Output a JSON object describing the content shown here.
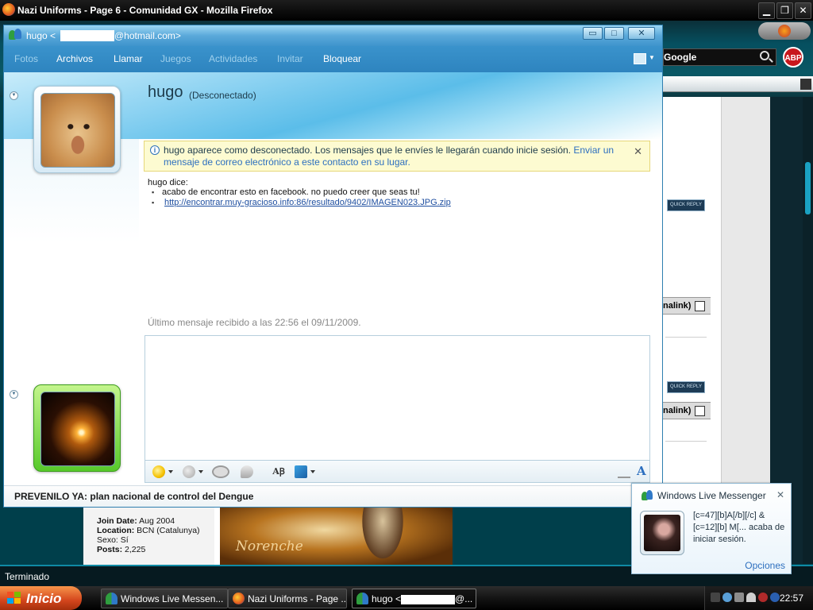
{
  "firefox": {
    "title": "Nazi Uniforms - Page 6 - Comunidad GX - Mozilla Firefox",
    "search_engine": "Google",
    "adblock_label": "ABP",
    "status": "Terminado",
    "win_buttons": [
      "▁",
      "❐",
      "✕"
    ]
  },
  "forum": {
    "quick_reply": "QUICK REPLY",
    "permalink": "nalink)",
    "join_date_label": "Join Date:",
    "join_date": "Aug 2004",
    "location_label": "Location:",
    "location": "BCN (Catalunya)",
    "sexo": "Sexo: Sí",
    "posts_label": "Posts:",
    "posts": "2,225",
    "banner_name": "Norenche"
  },
  "messenger": {
    "title_prefix": "hugo <",
    "title_suffix": "@hotmail.com>",
    "win_buttons": [
      "▭",
      "□",
      "✕"
    ],
    "menu": [
      {
        "label": "Fotos",
        "enabled": false
      },
      {
        "label": "Archivos",
        "enabled": true
      },
      {
        "label": "Llamar",
        "enabled": true
      },
      {
        "label": "Juegos",
        "enabled": false
      },
      {
        "label": "Actividades",
        "enabled": false
      },
      {
        "label": "Invitar",
        "enabled": false
      },
      {
        "label": "Bloquear",
        "enabled": true
      }
    ],
    "contact_name": "hugo",
    "contact_status": "(Desconectado)",
    "notice": {
      "text": "hugo aparece como desconectado. Los mensajes que le envíes le llegarán cuando inicie sesión. ",
      "link": "Enviar un mensaje de correo electrónico a este contacto en su lugar.",
      "close": "✕"
    },
    "conversation": {
      "sender_line": "hugo dice:",
      "message": "acabo de encontrar esto en facebook. no puedo creer que seas tu!",
      "url": "http://encontrar.muy-gracioso.info:86/resultado/9402/IMAGEN023.JPG.zip"
    },
    "last_message": "Último mensaje recibido a las 22:56 el 09/11/2009.",
    "footer": "PREVENILO YA: plan nacional de control del Dengue",
    "toolbar": {
      "font_label": "AꞴ",
      "big_a": "A"
    }
  },
  "toast": {
    "title": "Windows Live Messenger",
    "close": "✕",
    "message": "[c=47][b]A[/b][/c] &[c=12][b] M[... acaba de iniciar sesión.",
    "options": "Opciones"
  },
  "taskbar": {
    "start": "Inicio",
    "tasks": [
      {
        "label": "Windows Live Messen...",
        "active": false
      },
      {
        "label": "Nazi Uniforms - Page ...",
        "active": false
      },
      {
        "label": "hugo <",
        "suffix": "@...",
        "active": true
      }
    ],
    "clock": "22:57"
  },
  "colors": {
    "messenger_accent": "#3a93cc",
    "link": "#2d6fbf",
    "notice_bg": "#fdfbd1",
    "start_orange": "#d4461d"
  }
}
